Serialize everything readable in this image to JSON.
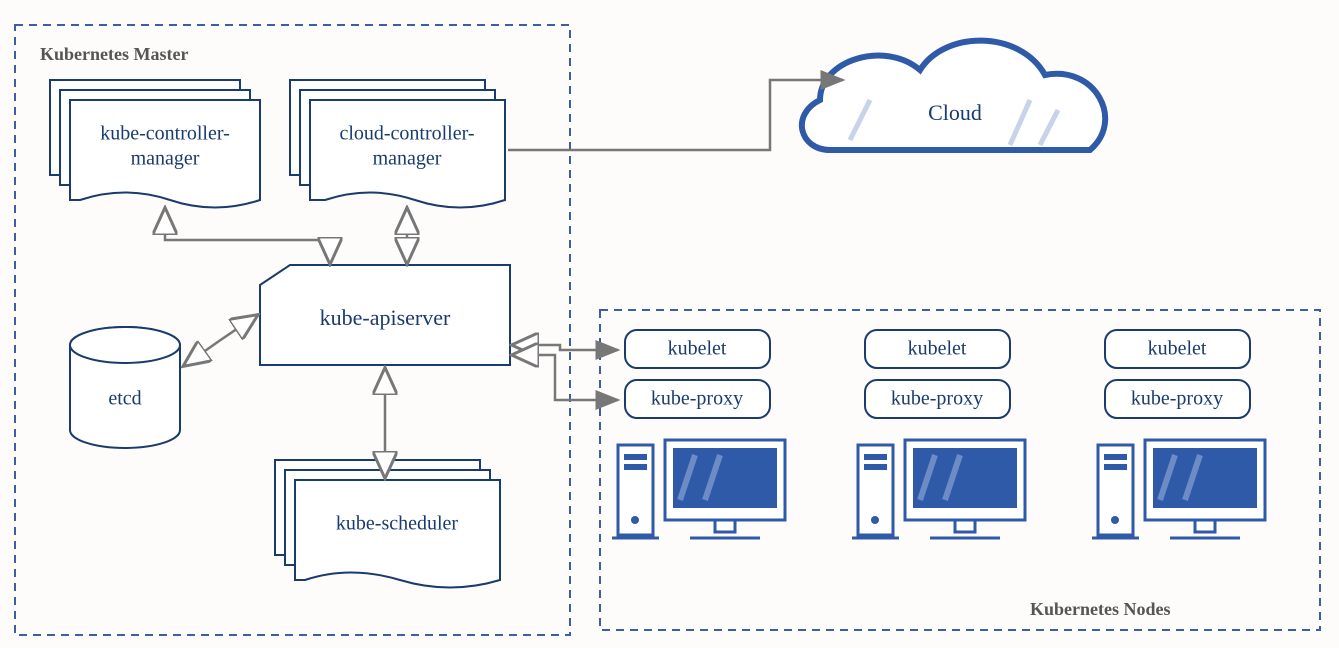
{
  "sections": {
    "master": "Kubernetes Master",
    "nodes": "Kubernetes Nodes"
  },
  "master": {
    "kube_controller_manager_l1": "kube-controller-",
    "kube_controller_manager_l2": "manager",
    "cloud_controller_manager_l1": "cloud-controller-",
    "cloud_controller_manager_l2": "manager",
    "kube_apiserver": "kube-apiserver",
    "etcd": "etcd",
    "kube_scheduler": "kube-scheduler"
  },
  "cloud": {
    "label": "Cloud"
  },
  "node": {
    "kubelet": "kubelet",
    "kube_proxy": "kube-proxy"
  },
  "colors": {
    "stroke": "#1a3b6e",
    "stroke_light": "#6d8bc4",
    "arrow": "#777777",
    "fill": "#ffffff"
  }
}
